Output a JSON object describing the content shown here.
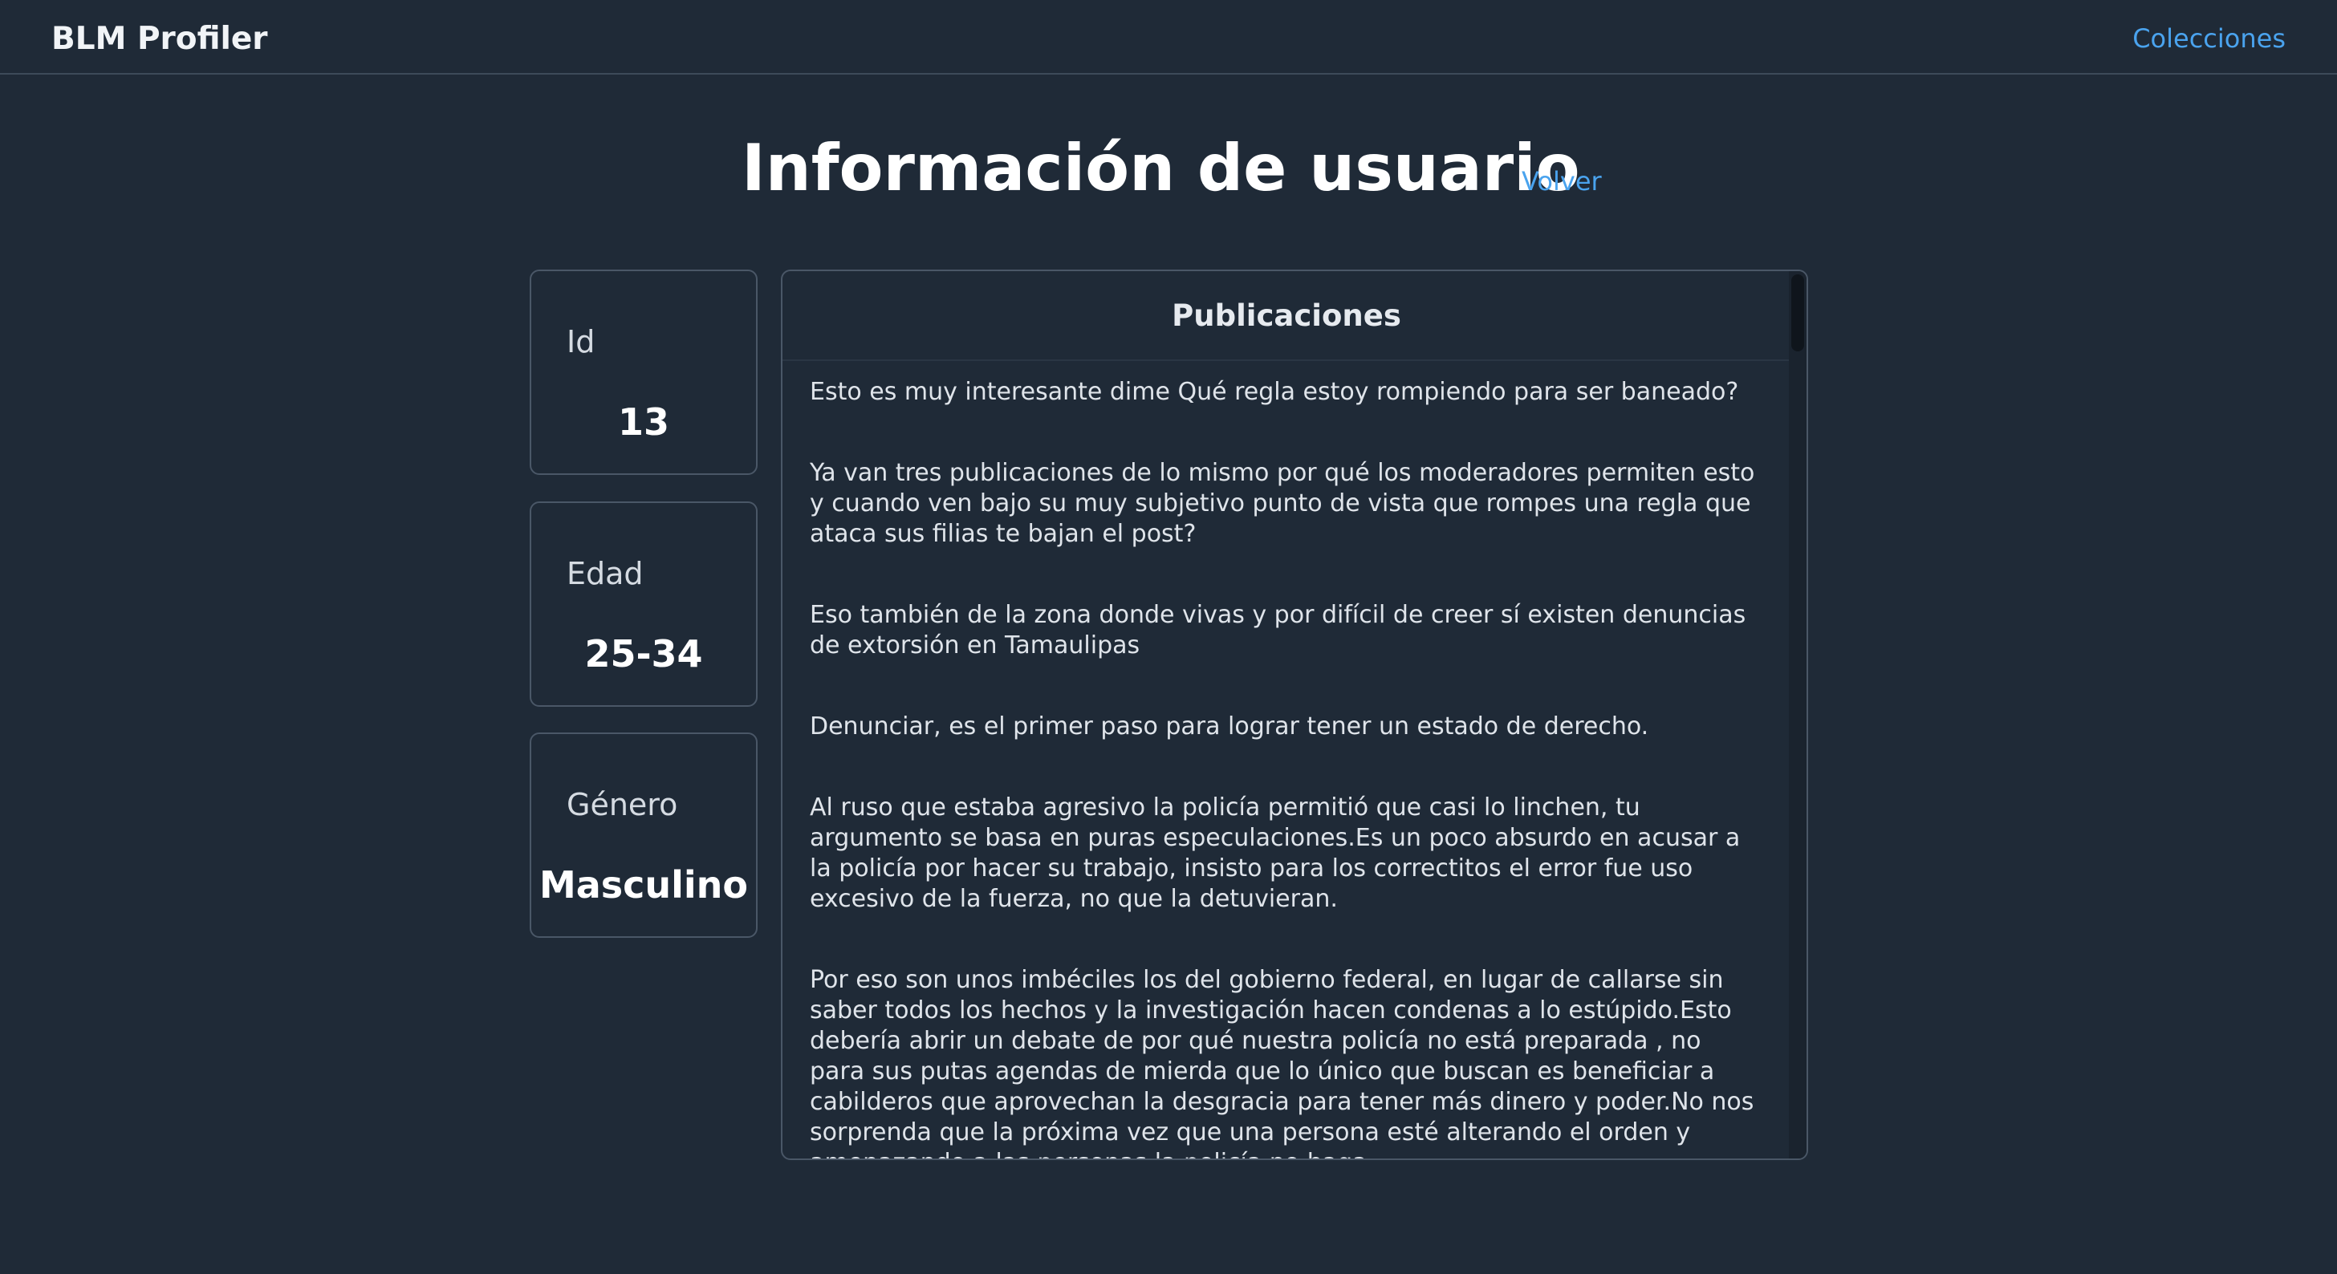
{
  "navbar": {
    "brand": "BLM Profiler",
    "collections_link": "Colecciones"
  },
  "header": {
    "title": "Información de usuario",
    "back_link": "Volver"
  },
  "user": {
    "id_label": "Id",
    "id_value": "13",
    "age_label": "Edad",
    "age_value": "25-34",
    "gender_label": "Género",
    "gender_value": "Masculino"
  },
  "posts": {
    "title": "Publicaciones",
    "items": [
      "Esto es muy interesante dime Qué regla estoy rompiendo para ser baneado?",
      "Ya van tres publicaciones de lo mismo por qué los moderadores permiten esto y cuando ven bajo su muy subjetivo punto de vista que rompes una regla que ataca sus filias te bajan el post?",
      "Eso también de la zona donde vivas y por difícil de creer sí existen denuncias de extorsión en Tamaulipas",
      "Denunciar, es el primer paso para lograr tener un estado de derecho.",
      "Al ruso que estaba agresivo la policía permitió que casi lo linchen, tu argumento se basa en puras especulaciones.Es un poco absurdo en acusar a la policía por hacer su trabajo, insisto para los correctitos el error fue uso excesivo de la fuerza, no que la detuvieran.",
      "Por eso son unos imbéciles los del gobierno federal, en lugar de callarse sin saber todos los hechos y la investigación hacen condenas a lo estúpido.Esto debería abrir un debate de por qué nuestra policía no está preparada , no para sus putas agendas de mierda que lo único que buscan es beneficiar a cabilderos que aprovechan la desgracia para tener más dinero y poder.No nos sorprenda que la próxima vez que una persona esté alterando el orden y amenazando a las personas la policía no haga"
    ]
  },
  "colors": {
    "background": "#1f2a37",
    "link": "#4aa3ee",
    "border": "#4a5767"
  }
}
